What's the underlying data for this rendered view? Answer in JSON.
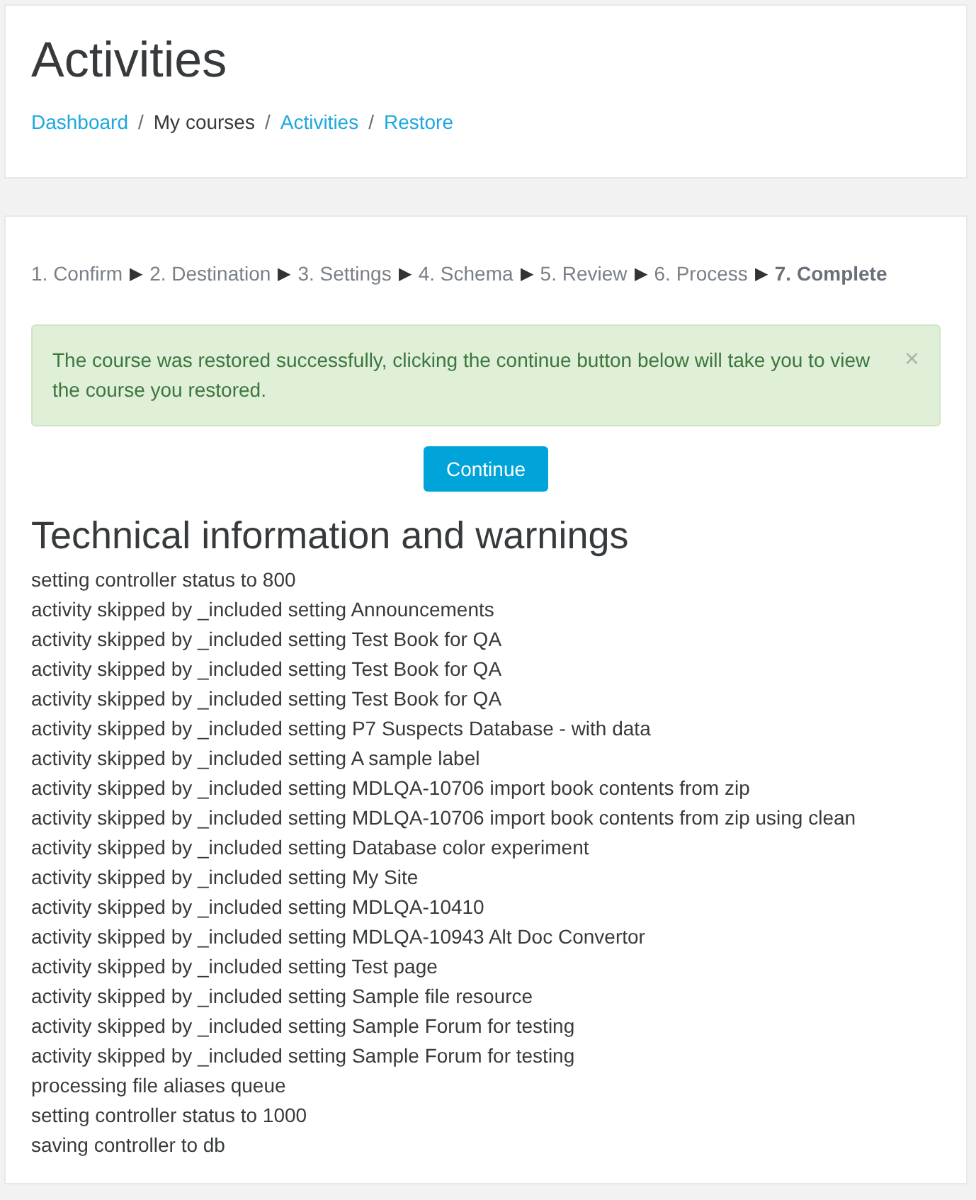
{
  "header": {
    "title": "Activities",
    "breadcrumb": [
      {
        "label": "Dashboard",
        "kind": "link",
        "separator": "/"
      },
      {
        "label": "My courses",
        "kind": "plain",
        "separator": "/"
      },
      {
        "label": "Activities",
        "kind": "link",
        "separator": "/"
      },
      {
        "label": "Restore",
        "kind": "link"
      }
    ]
  },
  "steps": [
    {
      "label": "1. Confirm",
      "selected": false,
      "arrow": "▶"
    },
    {
      "label": "2. Destination",
      "selected": false,
      "arrow": "▶"
    },
    {
      "label": "3. Settings",
      "selected": false,
      "arrow": "▶"
    },
    {
      "label": "4. Schema",
      "selected": false,
      "arrow": "▶"
    },
    {
      "label": "5. Review",
      "selected": false,
      "arrow": "▶"
    },
    {
      "label": "6. Process",
      "selected": false,
      "arrow": "▶"
    },
    {
      "label": "7. Complete",
      "selected": true
    }
  ],
  "alert": {
    "message": "The course was restored successfully, clicking the continue button below will take you to view the course you restored.",
    "close": "×"
  },
  "continue_button": "Continue",
  "log": {
    "heading": "Technical information and warnings",
    "lines": [
      "setting controller status to 800",
      "activity skipped by _included setting Announcements",
      "activity skipped by _included setting Test Book for QA",
      "activity skipped by _included setting Test Book for QA",
      "activity skipped by _included setting Test Book for QA",
      "activity skipped by _included setting P7 Suspects Database - with data",
      "activity skipped by _included setting A sample label",
      "activity skipped by _included setting MDLQA-10706 import book contents from zip",
      "activity skipped by _included setting MDLQA-10706 import book contents from zip using clean",
      "activity skipped by _included setting Database color experiment",
      "activity skipped by _included setting My Site",
      "activity skipped by _included setting MDLQA-10410",
      "activity skipped by _included setting MDLQA-10943 Alt Doc Convertor",
      "activity skipped by _included setting Test page",
      "activity skipped by _included setting Sample file resource",
      "activity skipped by _included setting Sample Forum for testing",
      "activity skipped by _included setting Sample Forum for testing",
      "processing file aliases queue",
      "setting controller status to 1000",
      "saving controller to db"
    ]
  }
}
